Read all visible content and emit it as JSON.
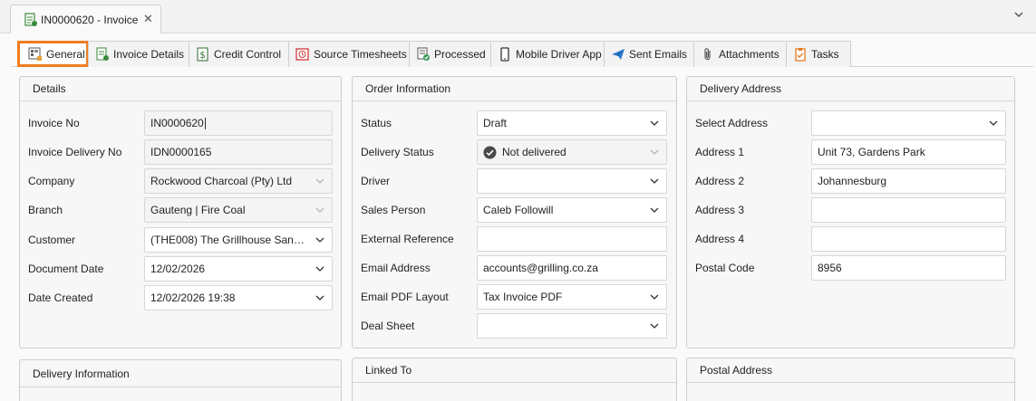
{
  "document_tab": {
    "title": "IN0000620 - Invoice",
    "close": "✕"
  },
  "tabs": [
    {
      "label": "General"
    },
    {
      "label": "Invoice Details"
    },
    {
      "label": "Credit Control"
    },
    {
      "label": "Source Timesheets"
    },
    {
      "label": "Processed"
    },
    {
      "label": "Mobile Driver App"
    },
    {
      "label": "Sent Emails"
    },
    {
      "label": "Attachments"
    },
    {
      "label": "Tasks"
    }
  ],
  "details": {
    "title": "Details",
    "invoice_no": {
      "label": "Invoice No",
      "value": "IN0000620"
    },
    "invoice_delivery_no": {
      "label": "Invoice Delivery No",
      "value": "IDN0000165"
    },
    "company": {
      "label": "Company",
      "value": "Rockwood Charcoal (Pty) Ltd"
    },
    "branch": {
      "label": "Branch",
      "value": "Gauteng | Fire Coal"
    },
    "customer": {
      "label": "Customer",
      "value": "(THE008) The Grillhouse Sandton ..."
    },
    "document_date": {
      "label": "Document Date",
      "value": "12/02/2026"
    },
    "date_created": {
      "label": "Date Created",
      "value": "12/02/2026 19:38"
    }
  },
  "order": {
    "title": "Order Information",
    "status": {
      "label": "Status",
      "value": "Draft"
    },
    "delivery_status": {
      "label": "Delivery Status",
      "value": "Not delivered"
    },
    "driver": {
      "label": "Driver",
      "value": ""
    },
    "sales_person": {
      "label": "Sales Person",
      "value": "Caleb Followill"
    },
    "external_reference": {
      "label": "External Reference",
      "value": ""
    },
    "email_address": {
      "label": "Email Address",
      "value": "accounts@grilling.co.za"
    },
    "email_pdf_layout": {
      "label": "Email PDF Layout",
      "value": "Tax Invoice PDF"
    },
    "deal_sheet": {
      "label": "Deal Sheet",
      "value": ""
    }
  },
  "delivery_address": {
    "title": "Delivery Address",
    "select_address": {
      "label": "Select Address",
      "value": ""
    },
    "address1": {
      "label": "Address 1",
      "value": "Unit 73, Gardens Park"
    },
    "address2": {
      "label": "Address 2",
      "value": "Johannesburg"
    },
    "address3": {
      "label": "Address 3",
      "value": ""
    },
    "address4": {
      "label": "Address 4",
      "value": ""
    },
    "postal_code": {
      "label": "Postal Code",
      "value": "8956"
    }
  },
  "bottom_panels": {
    "delivery_information": "Delivery Information",
    "linked_to": "Linked To",
    "postal_address": "Postal Address"
  },
  "colors": {
    "active_tab_border": "#ef7d22",
    "status_ok": "#4a4a4a"
  }
}
